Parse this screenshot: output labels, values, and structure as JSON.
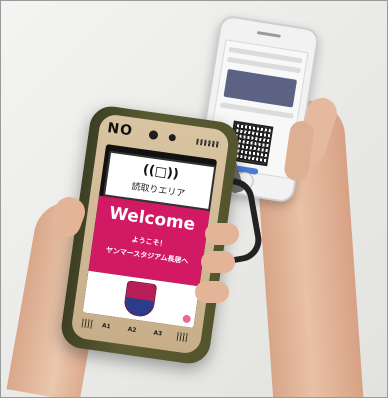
{
  "device": {
    "model_label": "NO",
    "reader_symbol": "((□))",
    "reader_text": "読取りエリア",
    "welcome": "Welcome",
    "greeting_line1": "ようこそ！",
    "greeting_line2": "ヤンマースタジアム長居へ",
    "keys": [
      "A1",
      "A2",
      "A3"
    ]
  },
  "colors": {
    "magenta": "#d21a64",
    "case": "#54552e",
    "bezel": "#d9c4a2"
  },
  "icons": [
    "qr-code-icon",
    "club-crest-icon",
    "nfc-reader-icon"
  ]
}
